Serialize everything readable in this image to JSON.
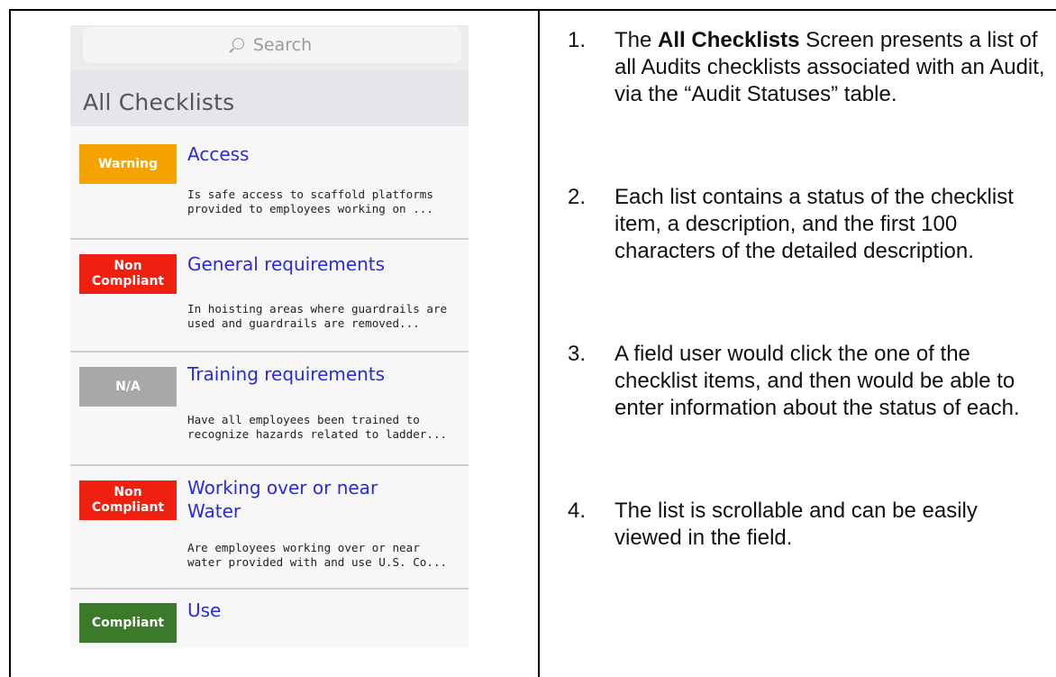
{
  "phone": {
    "search_placeholder": "Search",
    "header_title": "All Checklists",
    "items": [
      {
        "status": "Warning",
        "status_color": "#f5a300",
        "title": "Access",
        "desc": "Is safe access to scaffold platforms\nprovided to employees working on ..."
      },
      {
        "status": "Non\nCompliant",
        "status_color": "#f02010",
        "title": "General requirements",
        "desc": "In hoisting areas where guardrails are\nused and guardrails are removed..."
      },
      {
        "status": "N/A",
        "status_color": "#a8a8a8",
        "title": "Training requirements",
        "desc": "Have all employees been trained to\nrecognize hazards related to ladder..."
      },
      {
        "status": "Non\nCompliant",
        "status_color": "#f02010",
        "title": "Working over or near\nWater",
        "desc": "Are employees working over or near\nwater provided with and use U.S. Co..."
      },
      {
        "status": "Compliant",
        "status_color": "#3a7a2a",
        "title": "Use",
        "desc": ""
      }
    ]
  },
  "steps": [
    {
      "num": "1.",
      "pre": "The ",
      "bold": "All Checklists",
      "post": " Screen presents a list of all Audits checklists associated with an Audit, via the “Audit Statuses” table."
    },
    {
      "num": "2.",
      "pre": "Each list contains a status of the checklist item, a description, and the first 100 characters of the detailed description.",
      "bold": "",
      "post": ""
    },
    {
      "num": "3.",
      "pre": "A field user would click the one of the checklist items, and then would be able to enter information about the status of each.",
      "bold": "",
      "post": ""
    },
    {
      "num": "4.",
      "pre": "The list is scrollable and can be easily viewed in the field.",
      "bold": "",
      "post": ""
    }
  ]
}
